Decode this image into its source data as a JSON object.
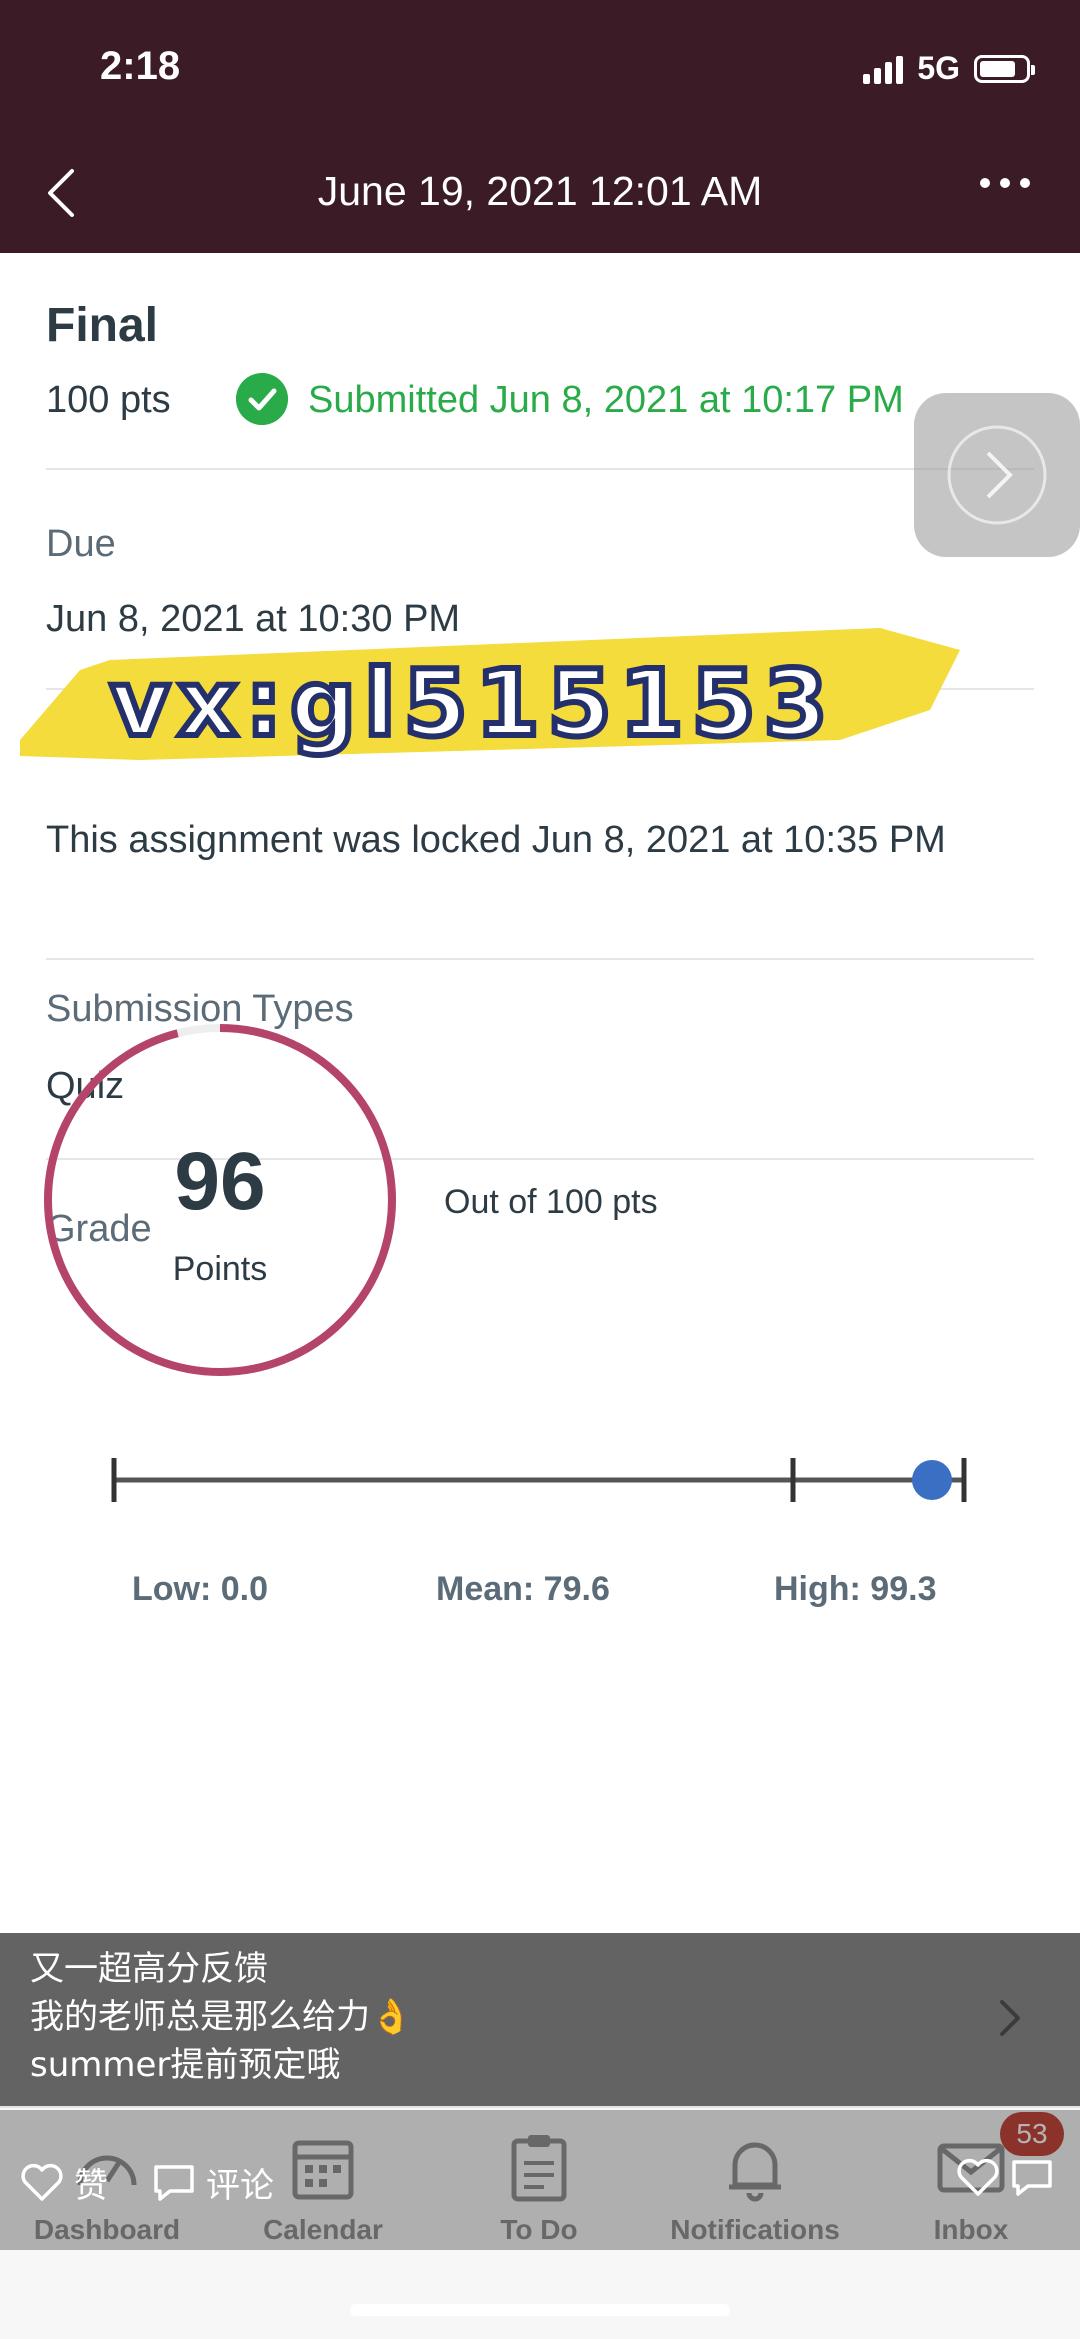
{
  "status": {
    "time": "2:18",
    "network": "5G"
  },
  "nav": {
    "title": "June 19, 2021 12:01 AM"
  },
  "assignment": {
    "title": "Final",
    "points": "100 pts",
    "submitted": "Submitted Jun 8, 2021 at 10:17 PM",
    "due_label": "Due",
    "due_value": "Jun 8, 2021 at 10:30 PM",
    "locked": "This assignment was locked Jun 8, 2021 at 10:35 PM",
    "submission_types_label": "Submission Types",
    "submission_types_value": "Quiz"
  },
  "grade": {
    "label": "Grade",
    "score": "96",
    "score_unit": "Points",
    "out_of": "Out of 100 pts",
    "score_fraction": 0.96,
    "low": "Low: 0.0",
    "mean": "Mean: 79.6",
    "high": "High: 99.3",
    "ring_color": "#b5446a",
    "marker_color": "#3b6fc4"
  },
  "watermark": {
    "text": "vx:gl515153",
    "color": "#f3dc3b"
  },
  "caption": {
    "line1": "又一超高分反馈",
    "line2": "我的老师总是那么给力👌",
    "line3": "summer提前预定哦"
  },
  "tabs": [
    {
      "label": "Dashboard",
      "icon": "dashboard-icon"
    },
    {
      "label": "Calendar",
      "icon": "calendar-icon"
    },
    {
      "label": "To Do",
      "icon": "todo-icon"
    },
    {
      "label": "Notifications",
      "icon": "bell-icon"
    },
    {
      "label": "Inbox",
      "icon": "inbox-icon"
    }
  ],
  "inbox_badge": "53",
  "social": {
    "like": "赞",
    "comment": "评论"
  }
}
